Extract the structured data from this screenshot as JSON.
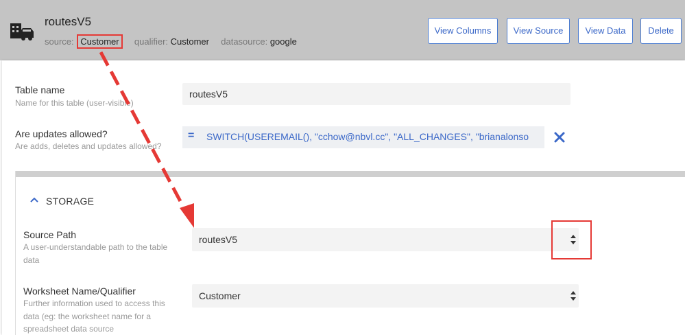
{
  "header": {
    "title": "routesV5",
    "meta": {
      "source_key": "source:",
      "source_value": "Customer",
      "qualifier_key": "qualifier:",
      "qualifier_value": "Customer",
      "datasource_key": "datasource:",
      "datasource_value": "google"
    },
    "buttons": {
      "view_columns": "View Columns",
      "view_source": "View Source",
      "view_data": "View Data",
      "delete": "Delete"
    }
  },
  "form": {
    "table_name": {
      "label": "Table name",
      "help": "Name for this table (user-visible)",
      "value": "routesV5"
    },
    "updates_allowed": {
      "label": "Are updates allowed?",
      "help": "Are adds, deletes and updates allowed?",
      "eq_symbol": "=",
      "formula": "SWITCH(USEREMAIL(),   \"cchow@nbvl.cc\", \"ALL_CHANGES\",   \"brianalonso"
    }
  },
  "storage": {
    "title": "STORAGE",
    "source_path": {
      "label": "Source Path",
      "help_line1": "A user-understandable path to the table",
      "help_line2": "data",
      "value": "routesV5"
    },
    "worksheet": {
      "label": "Worksheet Name/Qualifier",
      "help_line1": "Further information used to access this",
      "help_line2": "data (eg: the worksheet name for a",
      "help_line3": "spreadsheet data source",
      "value": "Customer"
    }
  },
  "icons": {
    "table": "building-car-icon",
    "close": "close-x-icon",
    "collapse": "chevron-up-icon",
    "select": "select-arrows-icon"
  },
  "colors": {
    "accent": "#3b68c8",
    "annotation": "#e53935",
    "header_bg": "#c4c4c4"
  }
}
